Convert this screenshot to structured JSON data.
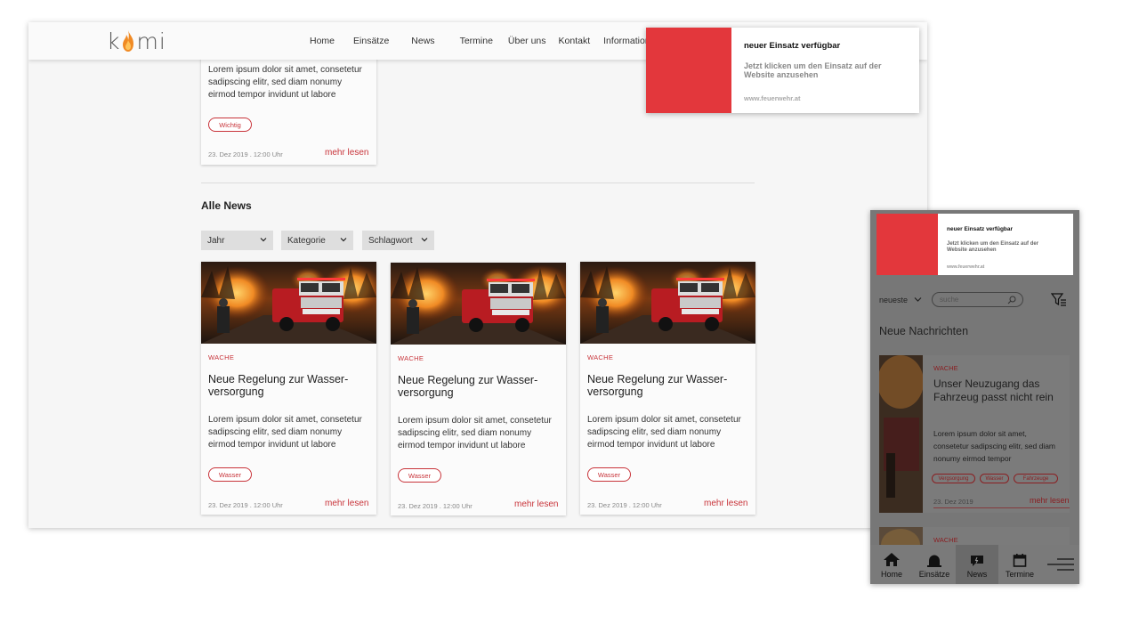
{
  "brand": {
    "logo_left": "k",
    "logo_right": "mi"
  },
  "nav": {
    "items": [
      "Home",
      "Einsätze",
      "News",
      "Termine",
      "Über uns",
      "Kontakt",
      "Informationen"
    ]
  },
  "top_card": {
    "text": "Lorem ipsum dolor sit amet, consetetur sadipscing elitr, sed diam nonumy eirmod tempor invidunt ut labore",
    "tag": "Wichtig",
    "date": "23. Dez 2019 . 12:00 Uhr",
    "more": "mehr lesen"
  },
  "section": {
    "title": "Alle News"
  },
  "filters": [
    "Jahr",
    "Kategorie",
    "Schlagwort"
  ],
  "news": [
    {
      "category": "WACHE",
      "title": "Neue Regelung zur Wasser-versorgung",
      "text": "Lorem ipsum dolor sit amet, consetetur sadipscing elitr, sed diam nonumy eirmod tempor invidunt ut labore",
      "tag": "Wasser",
      "date": "23. Dez 2019 . 12:00 Uhr",
      "more": "mehr lesen"
    },
    {
      "category": "WACHE",
      "title": "Neue Regelung zur Wasser-versorgung",
      "text": "Lorem ipsum dolor sit amet, consetetur sadipscing elitr, sed diam nonumy eirmod tempor invidunt ut labore",
      "tag": "Wasser",
      "date": "23. Dez 2019 . 12:00 Uhr",
      "more": "mehr lesen"
    },
    {
      "category": "WACHE",
      "title": "Neue Regelung zur Wasser-versorgung",
      "text": "Lorem ipsum dolor sit amet, consetetur sadipscing elitr, sed diam nonumy eirmod tempor invidunt ut labore",
      "tag": "Wasser",
      "date": "23. Dez 2019 . 12:00 Uhr",
      "more": "mehr lesen"
    }
  ],
  "notification": {
    "title": "neuer Einsatz verfügbar",
    "body": "Jetzt klicken um den Einsatz auf der Website anzusehen",
    "url": "www.feuerwehr.at"
  },
  "mobile": {
    "sort": "neueste",
    "search_placeholder": "suche",
    "heading": "Neue Nachrichten",
    "card": {
      "category": "WACHE",
      "title": "Unser Neuzugang das Fahrzeug passt nicht rein",
      "text": "Lorem ipsum dolor sit amet, consetetur sadipscing elitr, sed diam nonumy eirmod tempor",
      "tags": [
        "Vergsorgung",
        "Wasser",
        "Fahrzeuge"
      ],
      "date": "23. Dez 2019",
      "more": "mehr lesen"
    },
    "card2": {
      "category": "WACHE"
    },
    "tabs": [
      "Home",
      "Einsätze",
      "News",
      "Termine"
    ],
    "active_tab": "News"
  },
  "colors": {
    "accent": "#c8343a",
    "notification_red": "#e3373c"
  }
}
